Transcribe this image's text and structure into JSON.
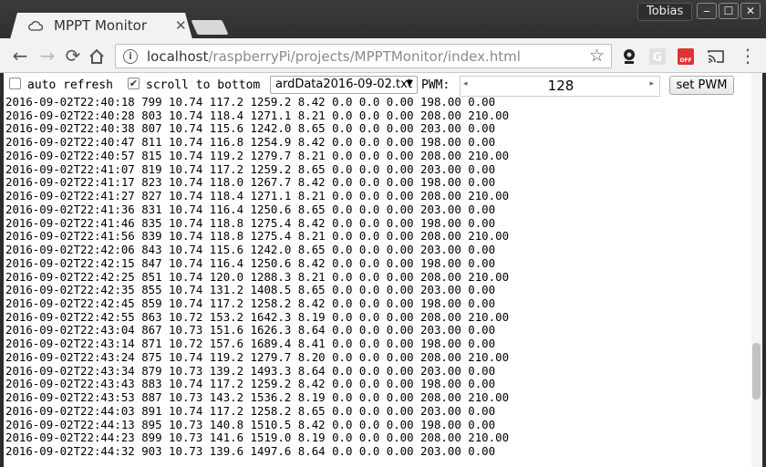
{
  "browser": {
    "tab_title": "MPPT Monitor",
    "tab_close": "✕",
    "profile_name": "Tobias",
    "window_buttons": [
      "‒",
      "☐",
      "✕"
    ],
    "url_host": "localhost",
    "url_rest": "/raspberryPi/projects/MPPTMonitor/index.html",
    "nav": {
      "back": "←",
      "forward": "→",
      "reload": "⟳"
    },
    "star": "☆"
  },
  "controls": {
    "auto_refresh_label": "auto refresh",
    "auto_refresh_checked": false,
    "scroll_label": "scroll to bottom",
    "scroll_checked": true,
    "file_selected": "ardData2016-09-02.txt",
    "pwm_label": "PWM:",
    "pwm_value": "128",
    "set_button": "set PWM"
  },
  "log_lines": [
    "2016-09-02T22:40:18 799 10.74 117.2 1259.2 8.42 0.0 0.0 0.00 198.00 0.00",
    "2016-09-02T22:40:28 803 10.74 118.4 1271.1 8.21 0.0 0.0 0.00 208.00 210.00",
    "2016-09-02T22:40:38 807 10.74 115.6 1242.0 8.65 0.0 0.0 0.00 203.00 0.00",
    "2016-09-02T22:40:47 811 10.74 116.8 1254.9 8.42 0.0 0.0 0.00 198.00 0.00",
    "2016-09-02T22:40:57 815 10.74 119.2 1279.7 8.21 0.0 0.0 0.00 208.00 210.00",
    "2016-09-02T22:41:07 819 10.74 117.2 1259.2 8.65 0.0 0.0 0.00 203.00 0.00",
    "2016-09-02T22:41:17 823 10.74 118.0 1267.7 8.42 0.0 0.0 0.00 198.00 0.00",
    "2016-09-02T22:41:27 827 10.74 118.4 1271.1 8.21 0.0 0.0 0.00 208.00 210.00",
    "2016-09-02T22:41:36 831 10.74 116.4 1250.6 8.65 0.0 0.0 0.00 203.00 0.00",
    "2016-09-02T22:41:46 835 10.74 118.8 1275.4 8.42 0.0 0.0 0.00 198.00 0.00",
    "2016-09-02T22:41:56 839 10.74 118.8 1275.4 8.21 0.0 0.0 0.00 208.00 210.00",
    "2016-09-02T22:42:06 843 10.74 115.6 1242.0 8.65 0.0 0.0 0.00 203.00 0.00",
    "2016-09-02T22:42:15 847 10.74 116.4 1250.6 8.42 0.0 0.0 0.00 198.00 0.00",
    "2016-09-02T22:42:25 851 10.74 120.0 1288.3 8.21 0.0 0.0 0.00 208.00 210.00",
    "2016-09-02T22:42:35 855 10.74 131.2 1408.5 8.65 0.0 0.0 0.00 203.00 0.00",
    "2016-09-02T22:42:45 859 10.74 117.2 1258.2 8.42 0.0 0.0 0.00 198.00 0.00",
    "2016-09-02T22:42:55 863 10.72 153.2 1642.3 8.19 0.0 0.0 0.00 208.00 210.00",
    "2016-09-02T22:43:04 867 10.73 151.6 1626.3 8.64 0.0 0.0 0.00 203.00 0.00",
    "2016-09-02T22:43:14 871 10.72 157.6 1689.4 8.41 0.0 0.0 0.00 198.00 0.00",
    "2016-09-02T22:43:24 875 10.74 119.2 1279.7 8.20 0.0 0.0 0.00 208.00 210.00",
    "2016-09-02T22:43:34 879 10.73 139.2 1493.3 8.64 0.0 0.0 0.00 203.00 0.00",
    "2016-09-02T22:43:43 883 10.74 117.2 1259.2 8.42 0.0 0.0 0.00 198.00 0.00",
    "2016-09-02T22:43:53 887 10.73 143.2 1536.2 8.19 0.0 0.0 0.00 208.00 210.00",
    "2016-09-02T22:44:03 891 10.74 117.2 1258.2 8.65 0.0 0.0 0.00 203.00 0.00",
    "2016-09-02T22:44:13 895 10.73 140.8 1510.5 8.42 0.0 0.0 0.00 198.00 0.00",
    "2016-09-02T22:44:23 899 10.73 141.6 1519.0 8.19 0.0 0.0 0.00 208.00 210.00",
    "2016-09-02T22:44:32 903 10.73 139.6 1497.6 8.64 0.0 0.0 0.00 203.00 0.00"
  ]
}
